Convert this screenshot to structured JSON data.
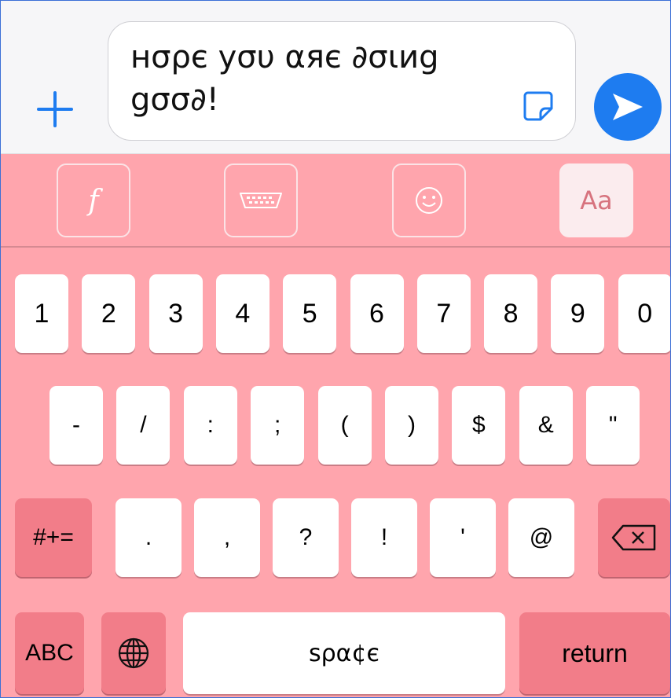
{
  "composer": {
    "message_text": "нσρє уσυ αяє ∂σιиg gσσ∂!",
    "send_label": "send"
  },
  "toolbar": {
    "font_label": "f",
    "aa_label": "Aa"
  },
  "keyboard": {
    "row1": [
      "1",
      "2",
      "3",
      "4",
      "5",
      "6",
      "7",
      "8",
      "9",
      "0"
    ],
    "row2": [
      "-",
      "/",
      ":",
      ";",
      "(",
      ")",
      "$",
      "&",
      "\""
    ],
    "row3": [
      ".",
      ",",
      "?",
      "!",
      "'",
      "@"
    ],
    "symbols_key": "#+=",
    "abc_key": "ABC",
    "space_key": "ѕρα¢є",
    "return_key": "return"
  },
  "colors": {
    "keyboard_bg": "#ffa5ad",
    "dark_key": "#f27d89",
    "accent": "#1e7cf0"
  },
  "icons": [
    "plus-icon",
    "sticker-icon",
    "send-icon",
    "font-icon",
    "keyboard-icon",
    "emoji-icon",
    "globe-icon",
    "delete-icon"
  ]
}
